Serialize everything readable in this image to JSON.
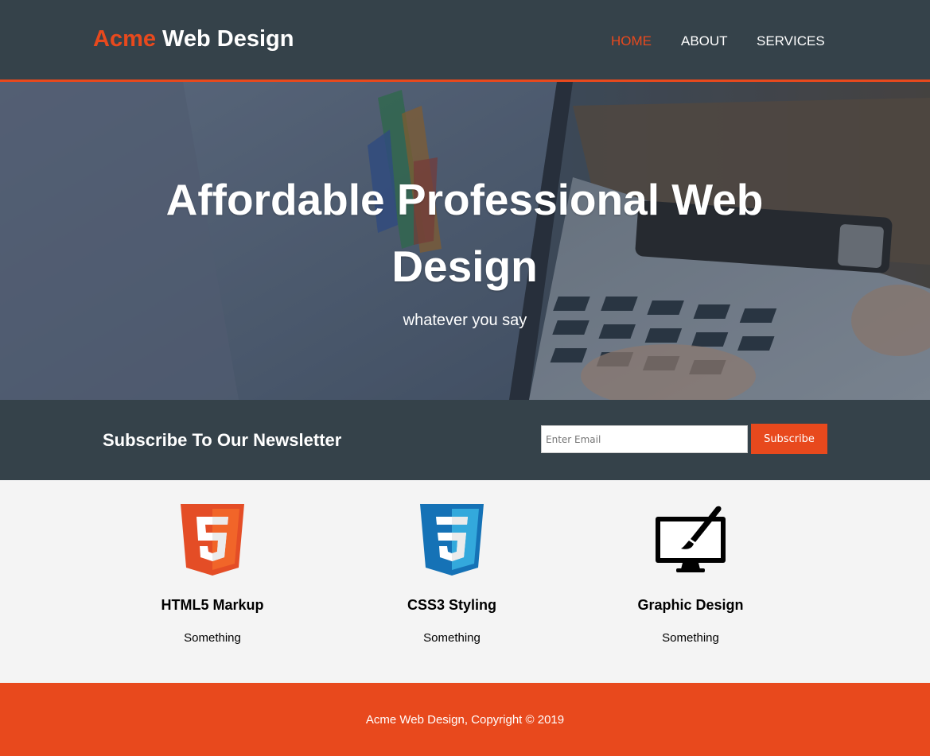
{
  "branding": {
    "highlight": "Acme",
    "rest": " Web Design"
  },
  "nav": {
    "items": [
      {
        "label": "HOME",
        "current": true
      },
      {
        "label": "ABOUT",
        "current": false
      },
      {
        "label": "SERVICES",
        "current": false
      }
    ]
  },
  "hero": {
    "title": "Affordable Professional Web Design",
    "subtitle": "whatever you say"
  },
  "newsletter": {
    "heading": "Subscribe To Our Newsletter",
    "email_placeholder": "Enter Email",
    "button_label": "Subscribe"
  },
  "boxes": [
    {
      "icon": "html5-logo-icon",
      "title": "HTML5 Markup",
      "text": "Something"
    },
    {
      "icon": "css3-logo-icon",
      "title": "CSS3 Styling",
      "text": "Something"
    },
    {
      "icon": "graphic-design-monitor-icon",
      "title": "Graphic Design",
      "text": "Something"
    }
  ],
  "footer": {
    "copyright": "Acme Web Design, Copyright © 2019"
  },
  "colors": {
    "dark": "#35424a",
    "accent": "#e8491d",
    "light": "#f4f4f4",
    "white": "#ffffff"
  }
}
